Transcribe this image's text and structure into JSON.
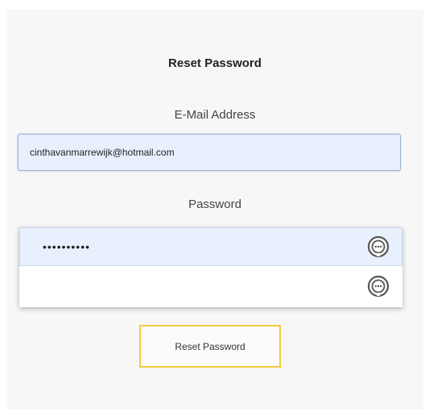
{
  "form": {
    "title": "Reset Password",
    "email": {
      "label": "E-Mail Address",
      "value": "cinthavanmarrewijk@hotmail.com"
    },
    "password": {
      "label": "Password",
      "value": "••••••••••"
    },
    "submit_label": "Reset Password"
  },
  "icons": {
    "password_manager": "password-key-icon"
  },
  "colors": {
    "autofill_background": "#e8f0fe",
    "button_border": "#f2cc3a",
    "panel_background": "#f7f7f7"
  }
}
